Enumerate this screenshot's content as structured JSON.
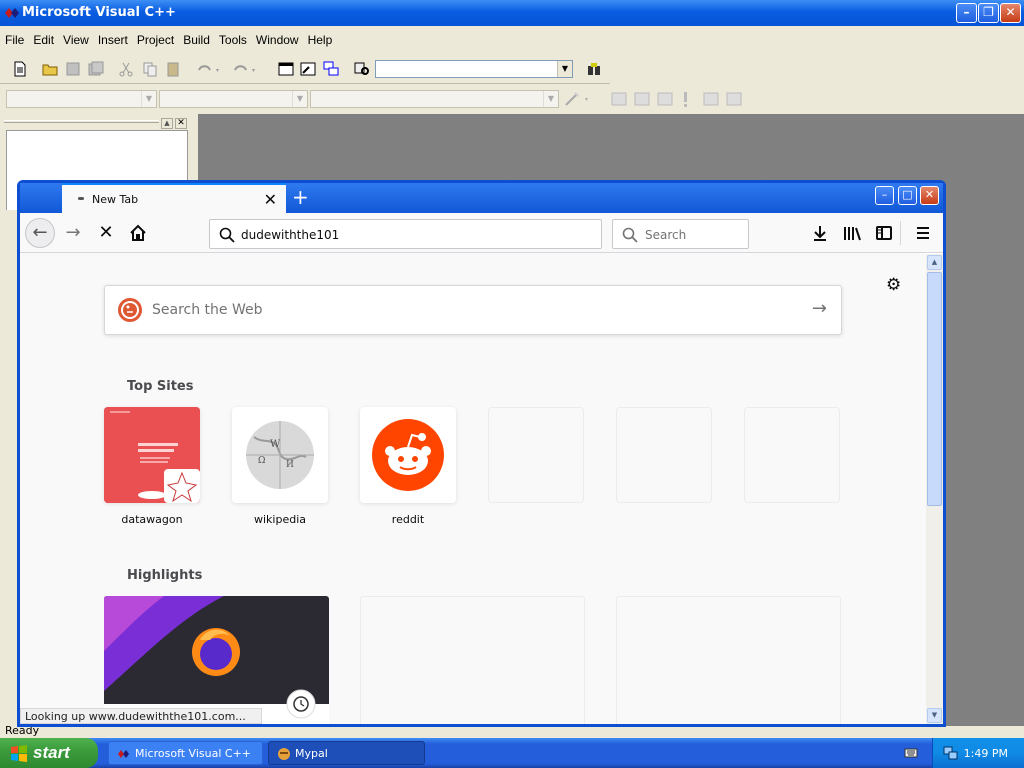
{
  "vc": {
    "title": "Microsoft Visual C++",
    "menu": [
      "File",
      "Edit",
      "View",
      "Insert",
      "Project",
      "Build",
      "Tools",
      "Window",
      "Help"
    ],
    "status": "Ready"
  },
  "firefox": {
    "tab_title": "New Tab",
    "url": "dudewiththe101",
    "search_placeholder": "Search",
    "web_search_placeholder": "Search the Web",
    "top_sites_title": "Top Sites",
    "top_sites": [
      "datawagon",
      "wikipedia",
      "reddit"
    ],
    "highlights_title": "Highlights",
    "status_text": "Looking up www.dudewiththe101.com..."
  },
  "taskbar": {
    "start_label": "start",
    "tasks": [
      "Microsoft Visual C++",
      "Mypal"
    ],
    "clock": "1:49 PM"
  },
  "colors": {
    "xp_blue": "#245edb",
    "start_green": "#3c9c3c",
    "reddit": "#ff4500",
    "duckduckgo": "#de5833"
  }
}
